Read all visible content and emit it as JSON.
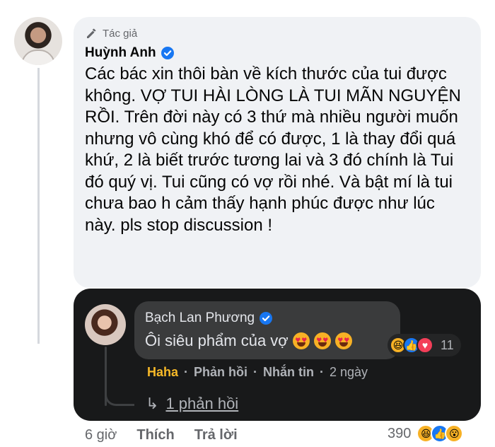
{
  "main_comment": {
    "badge": "Tác giả",
    "author": "Huỳnh Anh",
    "text": "Các bác xin thôi bàn về kích thước của tui được không. VỢ TUI HÀI LÒNG LÀ TUI MÃN NGUYỆN RỒI. Trên đời này có 3 thứ mà nhiều người muốn nhưng vô cùng khó để có được, 1 là thay đổi quá khứ, 2 là biết trước tương lai và 3 đó chính là Tui đó quý vị. Tui cũng có vợ rồi nhé. Và bật mí là tui chưa bao h cảm thấy hạnh phúc được như lúc này. pls stop discussion !",
    "time": "6 giờ",
    "like": "Thích",
    "reply": "Trả lời",
    "reaction_count": "390"
  },
  "reply": {
    "author": "Bạch Lan Phương",
    "text": "Ôi siêu phẩm của vợ",
    "reaction_count": "11",
    "action_haha": "Haha",
    "action_reply": "Phản hồi",
    "action_message": "Nhắn tin",
    "time": "2 ngày",
    "more_replies": "1 phản hồi"
  },
  "colors": {
    "light_bubble": "#f0f2f5",
    "dark_panel": "#18191a",
    "dark_bubble": "#3a3b3c",
    "verified_blue": "#1877f2",
    "haha_yellow": "#f7b928"
  },
  "icons": {
    "badge": "pen-icon",
    "verified": "verified-badge-icon",
    "emoji": "heart-eyes-emoji-icon",
    "reply_arrow": "reply-arrow-icon"
  }
}
